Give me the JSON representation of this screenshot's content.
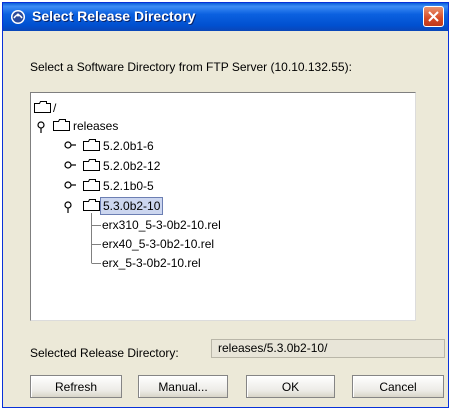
{
  "window": {
    "title": "Select Release Directory"
  },
  "prompt": "Select a Software Directory from FTP Server (10.10.132.55):",
  "tree": {
    "root": "/",
    "releases": "releases",
    "dirs": [
      "5.2.0b1-6",
      "5.2.0b2-12",
      "5.2.1b0-5",
      "5.3.0b2-10"
    ],
    "files": [
      "erx310_5-3-0b2-10.rel",
      "erx40_5-3-0b2-10.rel",
      "erx_5-3-0b2-10.rel"
    ],
    "selected": "5.3.0b2-10"
  },
  "selected_dir": {
    "label": "Selected Release Directory:",
    "value": "releases/5.3.0b2-10/"
  },
  "buttons": {
    "refresh": "Refresh",
    "manual": "Manual...",
    "ok": "OK",
    "cancel": "Cancel"
  },
  "colors": {
    "titlebar": "#0054e3",
    "dialog_bg": "#ece9d8",
    "selection": "#ccd6ef"
  }
}
